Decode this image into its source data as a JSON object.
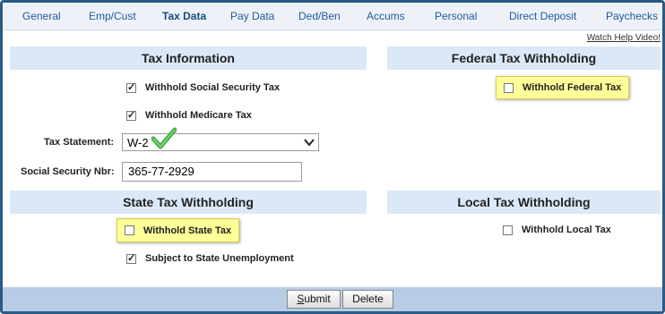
{
  "tabs": [
    {
      "label": "General"
    },
    {
      "label": "Emp/Cust"
    },
    {
      "label": "Tax Data"
    },
    {
      "label": "Pay Data"
    },
    {
      "label": "Ded/Ben"
    },
    {
      "label": "Accums"
    },
    {
      "label": "Personal"
    },
    {
      "label": "Direct Deposit"
    },
    {
      "label": "Paychecks"
    }
  ],
  "help_link": "Watch Help Video!",
  "sections": {
    "tax_info": "Tax Information",
    "federal": "Federal Tax Withholding",
    "state": "State Tax Withholding",
    "local": "Local Tax Withholding"
  },
  "checkboxes": {
    "social_security": {
      "label": "Withhold Social Security Tax",
      "checked": true
    },
    "medicare": {
      "label": "Withhold Medicare Tax",
      "checked": true
    },
    "federal": {
      "label": "Withhold Federal Tax",
      "checked": false
    },
    "state": {
      "label": "Withhold State Tax",
      "checked": false
    },
    "state_unemployment": {
      "label": "Subject to State Unemployment",
      "checked": true
    },
    "local": {
      "label": "Withhold Local Tax",
      "checked": false
    }
  },
  "tax_statement": {
    "label": "Tax Statement:",
    "value": "W-2"
  },
  "ssn": {
    "label": "Social Security Nbr:",
    "value": "365-77-2929"
  },
  "buttons": {
    "submit_rest": "ubmit",
    "submit_key": "S",
    "delete": "Delete"
  },
  "colors": {
    "accent": "#1e5aa0",
    "highlight": "#ffff99",
    "section_bg": "#dbe8f7",
    "checkmark": "#3aa83a"
  }
}
